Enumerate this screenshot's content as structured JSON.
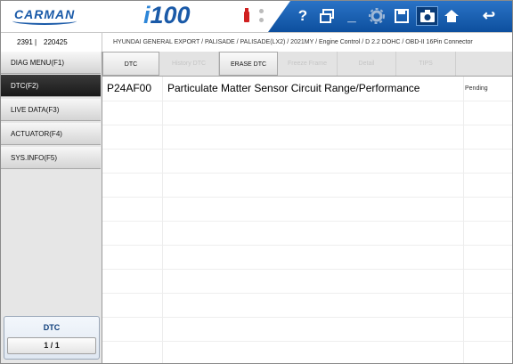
{
  "header": {
    "logo": "CARMAN",
    "product_prefix": "i",
    "product_suffix": "100",
    "icons": [
      "help-icon",
      "window-icon",
      "minimize-icon",
      "settings-icon",
      "save-icon",
      "camera-icon",
      "home-icon",
      "back-icon"
    ],
    "icon_glyphs": {
      "help": "?",
      "minimize": "_",
      "back": "↩"
    }
  },
  "vehicle": {
    "code1": "2391",
    "separator": "|",
    "code2": "220425",
    "path": "HYUNDAI GENERAL EXPORT / PALISADE / PALISADE(LX2) / 2021MY / Engine Control / D 2.2 DOHC / OBD-II 16Pin Connector"
  },
  "sidebar": {
    "items": [
      {
        "label": "DIAG MENU(F1)"
      },
      {
        "label": "DTC(F2)"
      },
      {
        "label": "LIVE DATA(F3)"
      },
      {
        "label": "ACTUATOR(F4)"
      },
      {
        "label": "SYS.INFO(F5)"
      }
    ],
    "active_index": 1,
    "counter_title": "DTC",
    "counter_value": "1 / 1"
  },
  "tabs": [
    {
      "label": "DTC",
      "enabled": true
    },
    {
      "label": "History DTC",
      "enabled": false
    },
    {
      "label": "ERASE DTC",
      "enabled": true
    },
    {
      "label": "Freeze Frame",
      "enabled": false
    },
    {
      "label": "Detail",
      "enabled": false
    },
    {
      "label": "TIPS",
      "enabled": false
    }
  ],
  "dtc_list": [
    {
      "code": "P24AF00",
      "description": "Particulate Matter Sensor Circuit Range/Performance",
      "status": "Pending"
    }
  ],
  "colors": {
    "brand_blue": "#1a5aa8",
    "active_menu": "#222222",
    "usb_red": "#d02020"
  }
}
